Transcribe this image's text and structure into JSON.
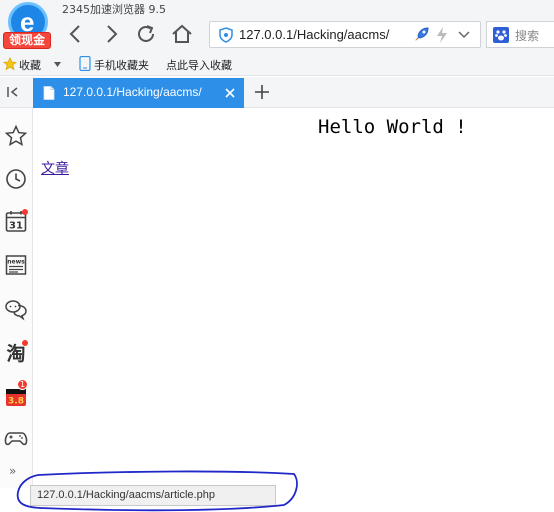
{
  "app": {
    "title": "2345加速浏览器 9.5",
    "promo_label": "领现金"
  },
  "toolbar": {
    "url": "127.0.0.1/Hacking/aacms/",
    "search_label": "搜索"
  },
  "bookmarks": {
    "favorites_label": "收藏",
    "mobile_label": "手机收藏夹",
    "import_label": "点此导入收藏"
  },
  "tabs": [
    {
      "title": "127.0.0.1/Hacking/aacms/",
      "active": true
    }
  ],
  "sidebar": {
    "calendar_day": "31",
    "news_label": "news",
    "taobao_label": "淘",
    "promo_badge": "1",
    "promo_label": "3.8",
    "more_label": "»"
  },
  "page": {
    "heading": "Hello World !",
    "link_text": "文章"
  },
  "statusbar": {
    "hover_url": "127.0.0.1/Hacking/aacms/article.php"
  },
  "colors": {
    "tab_active": "#2e8fe9",
    "logo_blue": "#1e86e6",
    "badge_red": "#f23a2f",
    "visited_link": "#3d1a9e",
    "annotation_blue": "#2028c8"
  }
}
